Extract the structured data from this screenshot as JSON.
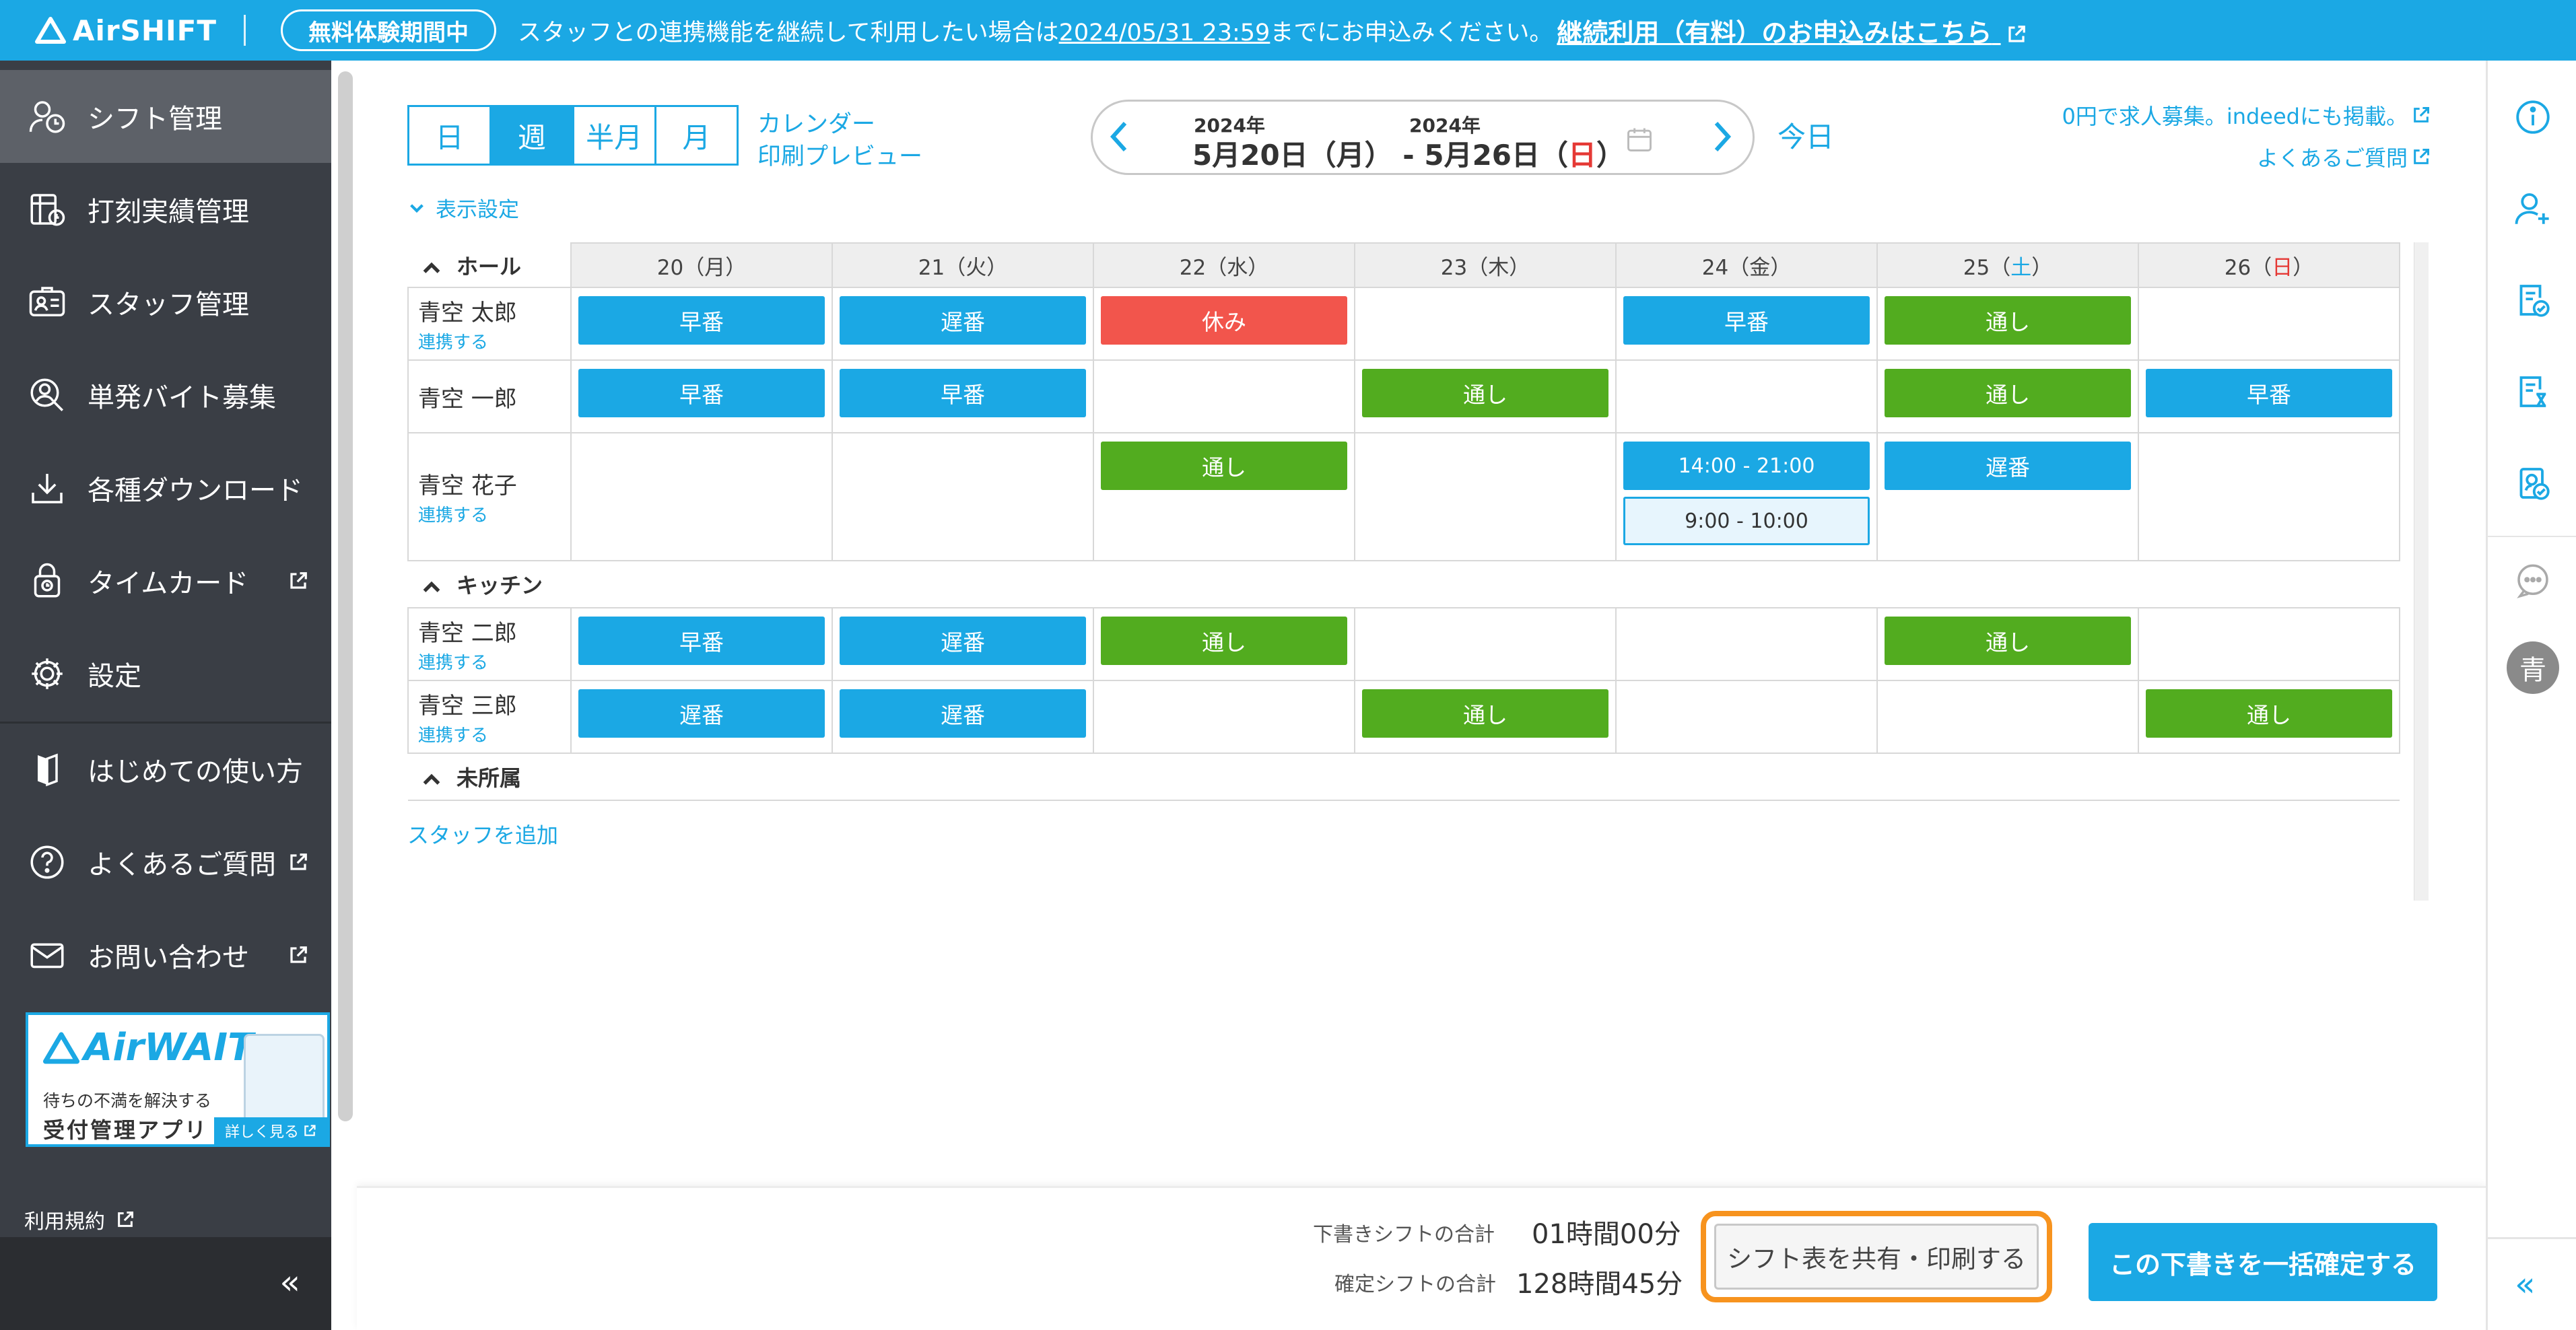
{
  "colors": {
    "accent": "#1ba8e4",
    "sidebar": "#3a3e45",
    "shift_blue": "#1ba8e4",
    "shift_green": "#52ac1f",
    "shift_red": "#f2554c",
    "highlight": "#f7931e",
    "sunday": "#e53935"
  },
  "topbar": {
    "logo": "AirSHIFT",
    "trial_badge": "無料体験期間中",
    "banner_prefix": "スタッフとの連携機能を継続して利用したい場合は",
    "banner_deadline": "2024/05/31 23:59",
    "banner_suffix": "までにお申込みください。",
    "banner_link": "継続利用（有料）のお申込みはこちら"
  },
  "sidebar": {
    "items": [
      {
        "label": "シフト管理",
        "icon": "person-clock-icon"
      },
      {
        "label": "打刻実績管理",
        "icon": "timesheet-icon"
      },
      {
        "label": "スタッフ管理",
        "icon": "id-card-icon"
      },
      {
        "label": "単発バイト募集",
        "icon": "person-search-icon"
      },
      {
        "label": "各種ダウンロード",
        "icon": "download-icon"
      },
      {
        "label": "タイムカード",
        "icon": "lock-clock-icon"
      },
      {
        "label": "設定",
        "icon": "gear-icon"
      },
      {
        "label": "はじめての使い方",
        "icon": "guide-icon"
      },
      {
        "label": "よくあるご質問",
        "icon": "question-icon"
      },
      {
        "label": "お問い合わせ",
        "icon": "mail-icon"
      }
    ],
    "ad": {
      "logo": "AirWAIT",
      "line1": "待ちの不満を解決する",
      "line2": "受付管理アプリ",
      "more": "詳しく見る"
    },
    "terms": "利用規約",
    "collapse": "«"
  },
  "view_tabs": [
    "日",
    "週",
    "半月",
    "月"
  ],
  "calendar_link_1": "カレンダー",
  "calendar_link_2": "印刷プレビュー",
  "date_nav": {
    "year_start": "2024年",
    "year_end": "2024年",
    "start": "5月20日（月）",
    "separator": "-",
    "end_prefix": "5月26日（",
    "end_day": "日",
    "end_suffix": "）"
  },
  "today": "今日",
  "top_links": {
    "recruit": "0円で求人募集。indeedにも掲載。",
    "faq": "よくあるご質問"
  },
  "display_settings": "表示設定",
  "table": {
    "days": [
      "20（月）",
      "21（火）",
      "22（水）",
      "23（木）",
      "24（金）"
    ],
    "sat": {
      "num": "25（",
      "day": "土",
      "end": "）"
    },
    "sun": {
      "num": "26（",
      "day": "日",
      "end": "）"
    },
    "groups": [
      {
        "name": "ホール",
        "staff": [
          {
            "name": "青空 太郎",
            "link": "連携する",
            "shifts": [
              [
                {
                  "label": "早番",
                  "kind": "blue"
                }
              ],
              [
                {
                  "label": "遅番",
                  "kind": "blue"
                }
              ],
              [
                {
                  "label": "休み",
                  "kind": "red"
                }
              ],
              [],
              [
                {
                  "label": "早番",
                  "kind": "blue"
                }
              ],
              [
                {
                  "label": "通し",
                  "kind": "green"
                }
              ],
              []
            ]
          },
          {
            "name": "青空 一郎",
            "link": "",
            "shifts": [
              [
                {
                  "label": "早番",
                  "kind": "blue"
                }
              ],
              [
                {
                  "label": "早番",
                  "kind": "blue"
                }
              ],
              [],
              [
                {
                  "label": "通し",
                  "kind": "green"
                }
              ],
              [],
              [
                {
                  "label": "通し",
                  "kind": "green"
                }
              ],
              [
                {
                  "label": "早番",
                  "kind": "blue"
                }
              ]
            ]
          },
          {
            "name": "青空 花子",
            "link": "連携する",
            "shifts": [
              [],
              [],
              [
                {
                  "label": "通し",
                  "kind": "green"
                }
              ],
              [],
              [
                {
                  "label": "14:00 - 21:00",
                  "kind": "blue time"
                },
                {
                  "label": "9:00 - 10:00",
                  "kind": "draft"
                }
              ],
              [
                {
                  "label": "遅番",
                  "kind": "blue"
                }
              ],
              []
            ]
          }
        ]
      },
      {
        "name": "キッチン",
        "staff": [
          {
            "name": "青空 二郎",
            "link": "連携する",
            "shifts": [
              [
                {
                  "label": "早番",
                  "kind": "blue"
                }
              ],
              [
                {
                  "label": "遅番",
                  "kind": "blue"
                }
              ],
              [
                {
                  "label": "通し",
                  "kind": "green"
                }
              ],
              [],
              [],
              [
                {
                  "label": "通し",
                  "kind": "green"
                }
              ],
              []
            ]
          },
          {
            "name": "青空 三郎",
            "link": "連携する",
            "shifts": [
              [
                {
                  "label": "遅番",
                  "kind": "blue"
                }
              ],
              [
                {
                  "label": "遅番",
                  "kind": "blue"
                }
              ],
              [],
              [
                {
                  "label": "通し",
                  "kind": "green"
                }
              ],
              [],
              [],
              [
                {
                  "label": "通し",
                  "kind": "green"
                }
              ]
            ]
          }
        ]
      },
      {
        "name": "未所属",
        "staff": []
      }
    ]
  },
  "add_staff": "スタッフを追加",
  "footer": {
    "draft_label": "下書きシフトの合計",
    "draft_value": "01時間00分",
    "confirmed_label": "確定シフトの合計",
    "confirmed_value": "128時間45分",
    "share_button": "シフト表を共有・印刷する",
    "confirm_button": "この下書きを一括確定する"
  },
  "rightbar": {
    "avatar": "青",
    "collapse": "«",
    "icons": [
      "info-icon",
      "add-person-icon",
      "shift-check-icon",
      "shift-clock-icon",
      "document-check-icon",
      "chat-icon"
    ]
  }
}
